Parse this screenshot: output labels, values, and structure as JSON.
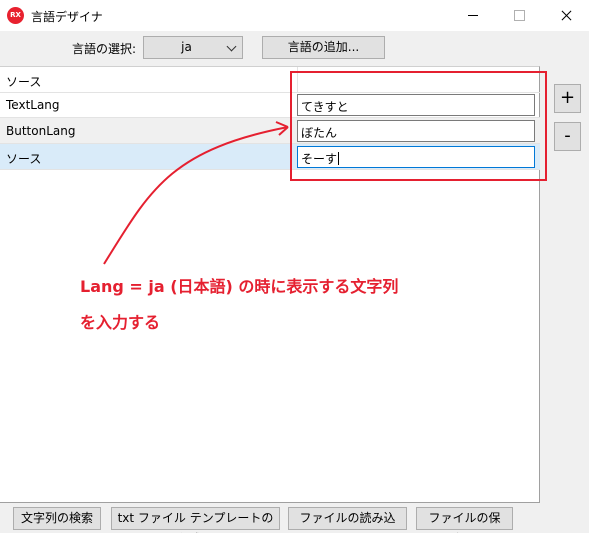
{
  "window": {
    "icon_text": "RX",
    "title": "言語デザイナ"
  },
  "toolbar": {
    "language_label": "言語の選択:",
    "language_value": "ja",
    "add_language_label": "言語の追加..."
  },
  "grid": {
    "header_label": "ソース",
    "rows": [
      {
        "key": "TextLang",
        "value": "てきすと"
      },
      {
        "key": "ButtonLang",
        "value": "ぼたん"
      },
      {
        "key": "ソース",
        "value": "そーす"
      }
    ]
  },
  "side_buttons": {
    "add_label": "+",
    "remove_label": "-"
  },
  "annotation": {
    "line1": "Lang = ja (日本語) の時に表示する文字列",
    "line2": "を入力する",
    "color": "#e52030"
  },
  "footer": {
    "search_label": "文字列の検索",
    "create_template_label": "txt ファイル テンプレートの作成...",
    "load_file_label": "ファイルの読み込み...",
    "save_file_label": "ファイルの保存..."
  }
}
